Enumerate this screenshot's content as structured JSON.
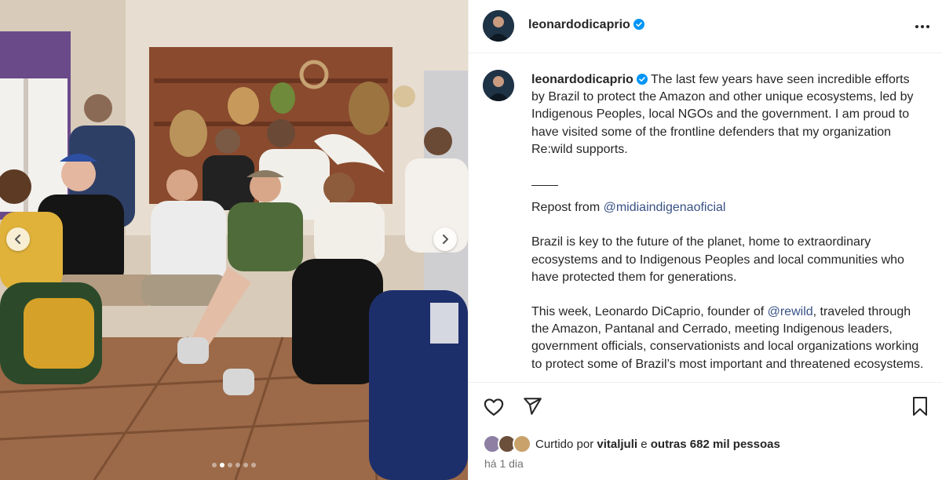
{
  "post": {
    "username": "leonardodicaprio",
    "verified": true,
    "caption_p1": "The last few years have seen incredible efforts by Brazil to protect the Amazon and other unique ecosystems, led by Indigenous Peoples, local NGOs and the government. I am proud to have visited some of the frontline defenders that my organization Re:wild supports.",
    "separator": "——",
    "repost_prefix": "Repost from ",
    "repost_handle": "@midiaindigenaoficial",
    "caption_p3": "Brazil is key to the future of the planet, home to extraordinary ecosystems and to Indigenous Peoples and local communities who have protected them for generations.",
    "caption_p4_a": "This week, Leonardo DiCaprio, founder of ",
    "caption_p4_handle": "@rewild",
    "caption_p4_b": ", traveled through the Amazon, Pantanal and Cerrado, meeting Indigenous leaders, government officials, conservationists and local organizations working to protect some of Brazil’s most important and threatened ecosystems."
  },
  "likes": {
    "prefix": "Curtido por ",
    "first_user": "vitaljuli",
    "middle": " e ",
    "others": "outras 682 mil pessoas"
  },
  "time_ago": "há 1 dia",
  "carousel": {
    "slide_count": 6,
    "active_index": 1
  },
  "icons": {
    "more": "more-options-icon",
    "like": "heart-icon",
    "share": "send-icon",
    "save": "bookmark-icon",
    "verified": "verified-badge-icon",
    "prev": "chevron-left-icon",
    "next": "chevron-right-icon"
  },
  "colors": {
    "verified_blue": "#0095f6",
    "mention_blue": "#385185",
    "text": "#262626",
    "secondary": "#737373"
  }
}
